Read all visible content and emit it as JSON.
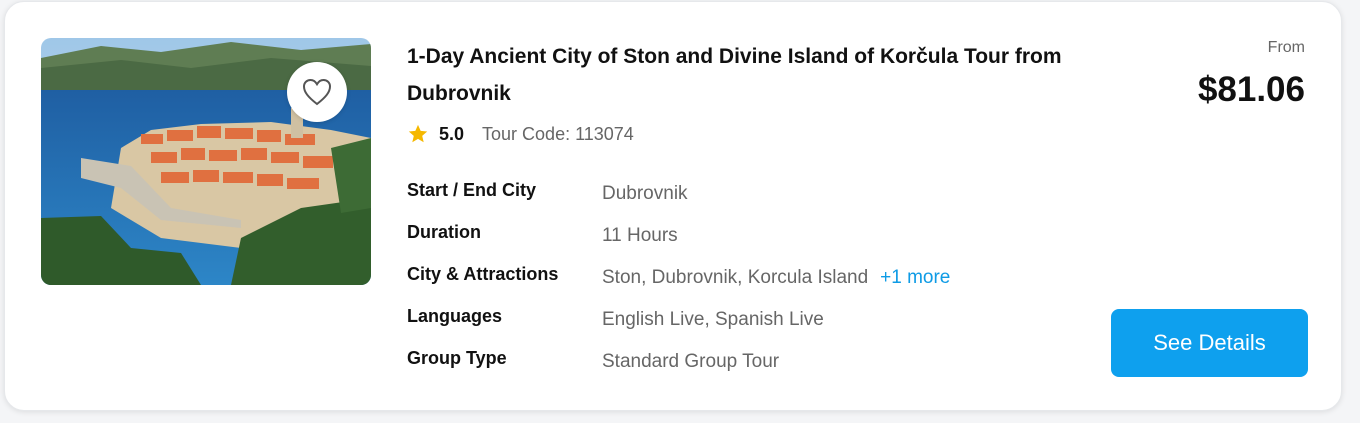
{
  "tour": {
    "title": "1-Day Ancient City of Ston and Divine Island of Korčula Tour from Dubrovnik",
    "rating": "5.0",
    "tour_code": "Tour Code: 113074",
    "details": [
      {
        "label": "Start / End City",
        "value": "Dubrovnik"
      },
      {
        "label": "Duration",
        "value": "11 Hours"
      },
      {
        "label": "City & Attractions",
        "value": "Ston, Dubrovnik, Korcula Island",
        "more": "+1 more"
      },
      {
        "label": "Languages",
        "value": "English Live, Spanish Live"
      },
      {
        "label": "Group Type",
        "value": "Standard Group Tour"
      }
    ]
  },
  "pricing": {
    "from_label": "From",
    "price": "$81.06"
  },
  "actions": {
    "see_details_label": "See Details"
  },
  "icons": {
    "favorite": "heart-outline-icon",
    "rating": "star-icon"
  },
  "colors": {
    "accent": "#0ea0ee",
    "link": "#0e9be5",
    "star": "#f5b800"
  }
}
